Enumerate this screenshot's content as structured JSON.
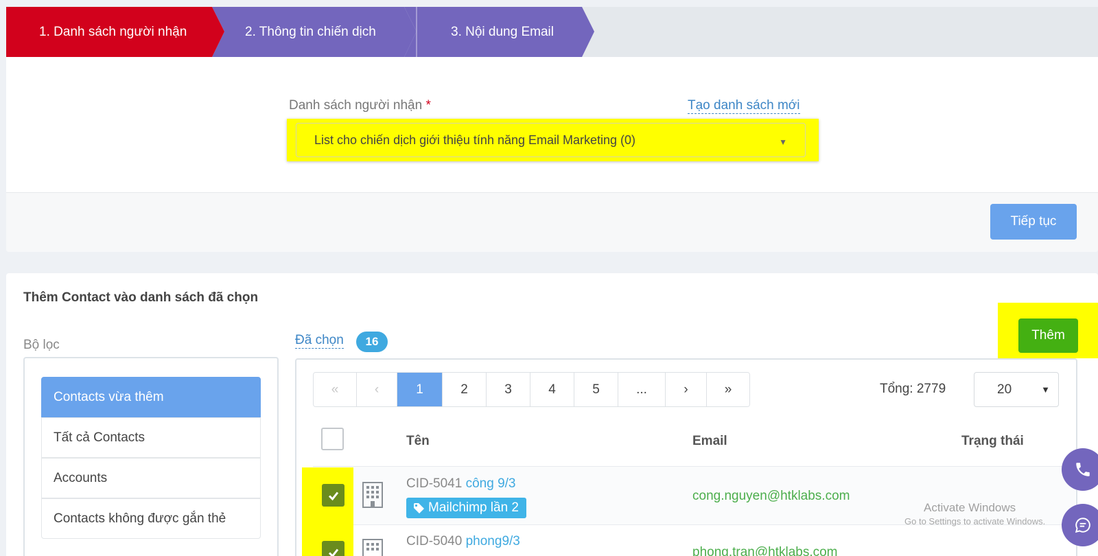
{
  "stepper": {
    "steps": [
      {
        "label": "1. Danh sách người nhận",
        "color": "#d2011c",
        "state": "active"
      },
      {
        "label": "2. Thông tin chiến dịch",
        "color": "#7366bd",
        "state": "pending"
      },
      {
        "label": "3. Nội dung Email",
        "color": "#7366bd",
        "state": "pending"
      }
    ]
  },
  "recipient_form": {
    "label": "Danh sách người nhận",
    "required_mark": "*",
    "create_link": "Tạo danh sách mới",
    "selected_list": "List cho chiến dịch giới thiệu tính năng Email Marketing (0)",
    "continue_button": "Tiếp tục"
  },
  "add_contacts": {
    "title": "Thêm Contact vào danh sách đã chọn",
    "filter_label": "Bộ lọc",
    "filters": [
      {
        "label": "Contacts vừa thêm",
        "active": true
      },
      {
        "label": "Tất cả Contacts",
        "active": false
      },
      {
        "label": "Accounts",
        "active": false
      },
      {
        "label": "Contacts không được gắn thẻ",
        "active": false
      }
    ],
    "selected_label": "Đã chọn",
    "selected_count": "16",
    "add_button": "Thêm",
    "pagination": {
      "first": "«",
      "prev": "‹",
      "pages": [
        "1",
        "2",
        "3",
        "4",
        "5",
        "..."
      ],
      "current_page": "1",
      "next": "›",
      "last": "»"
    },
    "total": "Tổng: 2779",
    "per_page": "20",
    "columns": {
      "name": "Tên",
      "email": "Email",
      "status": "Trạng thái"
    },
    "rows": [
      {
        "cid": "CID-5041",
        "name": "công 9/3",
        "tag": "Mailchimp lần 2",
        "email": "cong.nguyen@htklabs.com",
        "checked": true,
        "icon": "building-icon"
      },
      {
        "cid": "CID-5040",
        "name": "phong9/3",
        "tag": "",
        "email": "phong.tran@htklabs.com",
        "checked": true,
        "icon": "building-icon"
      }
    ]
  },
  "overlay": {
    "watermark_title": "Activate Windows",
    "watermark_sub": "Go to Settings to activate Windows.",
    "fab_icons": [
      "phone-icon",
      "chat-icon"
    ]
  },
  "colors": {
    "primary_red": "#d2011c",
    "step_purple": "#7366bd",
    "button_blue": "#69a3ec",
    "add_green": "#44b012",
    "highlight": "#ffff00",
    "link_blue": "#3d86c6",
    "email_green": "#4cae4c"
  }
}
